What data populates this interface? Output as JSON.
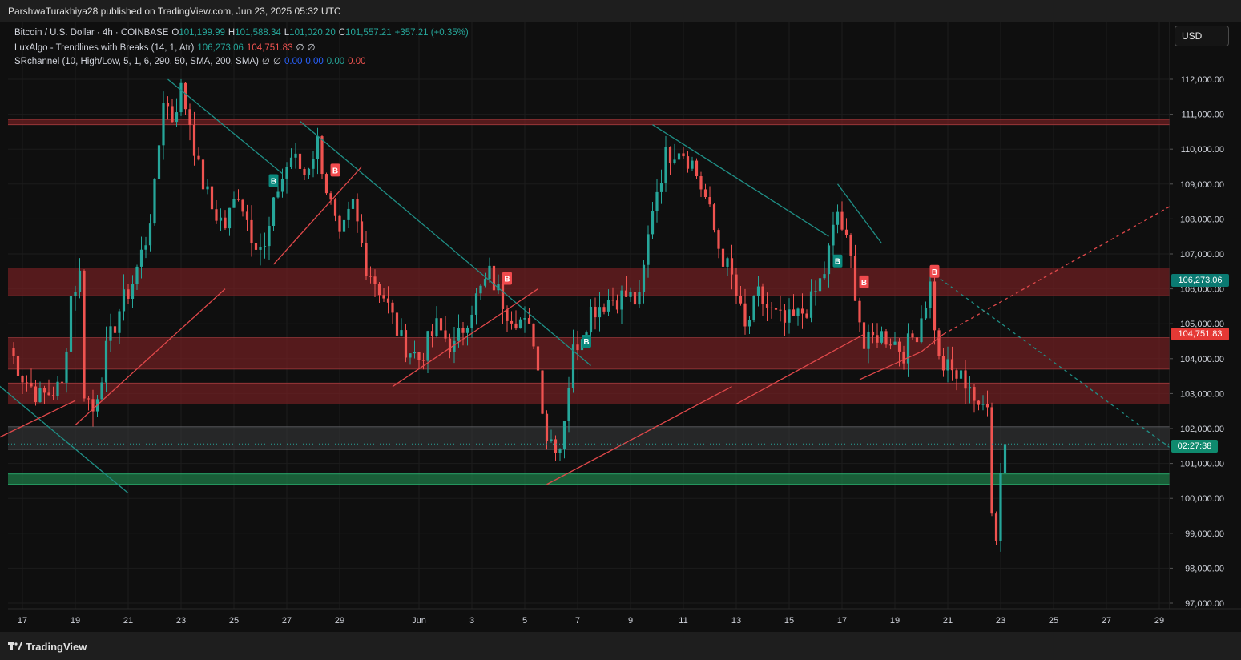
{
  "header": {
    "publish_text": "ParshwaTurakhiya28 published on TradingView.com, Jun 23, 2025 05:32 UTC"
  },
  "legend": {
    "line1": {
      "symbol": "Bitcoin / U.S. Dollar · 4h · COINBASE",
      "o_label": "O",
      "o": "101,199.99",
      "h_label": "H",
      "h": "101,588.34",
      "l_label": "L",
      "l": "101,020.20",
      "c_label": "C",
      "c": "101,557.21",
      "change": "+357.21 (+0.35%)"
    },
    "line2": {
      "name": "LuxAlgo - Trendlines with Breaks (14, 1, Atr)",
      "v1": "106,273.06",
      "v2": "104,751.83",
      "v3": "∅",
      "v4": "∅"
    },
    "line3": {
      "name": "SRchannel (10, High/Low, 5, 1, 6, 290, 50, SMA, 200, SMA)",
      "v1": "∅",
      "v2": "∅",
      "v3": "0.00",
      "v4": "0.00",
      "v5": "0.00",
      "v6": "0.00"
    }
  },
  "currency_button": "USD",
  "price_tags": {
    "upper_trend": "106,273.06",
    "lower_trend": "104,751.83",
    "countdown": "02:27:38"
  },
  "footer": {
    "brand": "TradingView"
  },
  "colors": {
    "up": "#26a69a",
    "down": "#ef5350",
    "zone_red": "#7a1f24",
    "zone_green": "#1e7a4a",
    "zone_gray": "#3a3a3a",
    "background": "#0f0f0f"
  },
  "chart_data": {
    "type": "candlestick",
    "ylim": [
      96600,
      112700
    ],
    "y_ticks": [
      97000,
      98000,
      99000,
      100000,
      101000,
      102000,
      103000,
      104000,
      105000,
      106000,
      107000,
      108000,
      109000,
      110000,
      111000,
      112000
    ],
    "y_tick_labels": [
      "97,000.00",
      "98,000.00",
      "99,000.00",
      "100,000.00",
      "101,000.00",
      "102,000.00",
      "103,000.00",
      "104,000.00",
      "105,000.00",
      "106,000.00",
      "107,000.00",
      "108,000.00",
      "109,000.00",
      "110,000.00",
      "111,000.00",
      "112,000.00"
    ],
    "x_ticks": [
      "May 17",
      "May 19",
      "May 21",
      "May 23",
      "May 25",
      "May 27",
      "May 29",
      "Jun 1",
      "Jun 3",
      "Jun 5",
      "Jun 7",
      "Jun 9",
      "Jun 11",
      "Jun 13",
      "Jun 15",
      "Jun 17",
      "Jun 19",
      "Jun 21",
      "Jun 23",
      "Jun 25",
      "Jun 27",
      "Jun 29"
    ],
    "x_tick_labels": [
      "17",
      "19",
      "21",
      "23",
      "25",
      "27",
      "29",
      "Jun",
      "3",
      "5",
      "7",
      "9",
      "11",
      "13",
      "15",
      "17",
      "19",
      "21",
      "23",
      "25",
      "27",
      "29"
    ],
    "last_close": 101557.21,
    "close_path": [
      [
        "May 16 12:00",
        104300
      ],
      [
        "May 17 00:00",
        103500
      ],
      [
        "May 17 16:00",
        102900
      ],
      [
        "May 18 12:00",
        103200
      ],
      [
        "May 18 20:00",
        105800
      ],
      [
        "May 19 04:00",
        106400
      ],
      [
        "May 19 08:00",
        103100
      ],
      [
        "May 19 16:00",
        102500
      ],
      [
        "May 20 04:00",
        104200
      ],
      [
        "May 20 16:00",
        105400
      ],
      [
        "May 21 04:00",
        106200
      ],
      [
        "May 21 16:00",
        107400
      ],
      [
        "May 22 00:00",
        108800
      ],
      [
        "May 22 08:00",
        111500
      ],
      [
        "May 22 16:00",
        110900
      ],
      [
        "May 23 00:00",
        111700
      ],
      [
        "May 23 08:00",
        110800
      ],
      [
        "May 23 16:00",
        109400
      ],
      [
        "May 24 04:00",
        108300
      ],
      [
        "May 24 16:00",
        107800
      ],
      [
        "May 25 04:00",
        108800
      ],
      [
        "May 25 16:00",
        107600
      ],
      [
        "May 26 04:00",
        107100
      ],
      [
        "May 26 16:00",
        108900
      ],
      [
        "May 27 04:00",
        109800
      ],
      [
        "May 27 16:00",
        109300
      ],
      [
        "May 28 04:00",
        110200
      ],
      [
        "May 28 12:00",
        108900
      ],
      [
        "May 29 00:00",
        107300
      ],
      [
        "May 29 12:00",
        108400
      ],
      [
        "May 30 00:00",
        106700
      ],
      [
        "May 30 16:00",
        105800
      ],
      [
        "May 31 08:00",
        104500
      ],
      [
        "Jun 1 00:00",
        104000
      ],
      [
        "Jun 1 16:00",
        104900
      ],
      [
        "Jun 2 08:00",
        104300
      ],
      [
        "Jun 3 00:00",
        105500
      ],
      [
        "Jun 3 16:00",
        106400
      ],
      [
        "Jun 4 08:00",
        105400
      ],
      [
        "Jun 4 20:00",
        105100
      ],
      [
        "Jun 5 08:00",
        104600
      ],
      [
        "Jun 5 20:00",
        101800
      ],
      [
        "Jun 6 08:00",
        101500
      ],
      [
        "Jun 6 20:00",
        104200
      ],
      [
        "Jun 7 12:00",
        105400
      ],
      [
        "Jun 8 04:00",
        105700
      ],
      [
        "Jun 8 20:00",
        105800
      ],
      [
        "Jun 9 08:00",
        105600
      ],
      [
        "Jun 9 20:00",
        108400
      ],
      [
        "Jun 10 08:00",
        109800
      ],
      [
        "Jun 10 20:00",
        110100
      ],
      [
        "Jun 11 08:00",
        109600
      ],
      [
        "Jun 11 20:00",
        108600
      ],
      [
        "Jun 12 08:00",
        107200
      ],
      [
        "Jun 12 20:00",
        106300
      ],
      [
        "Jun 13 08:00",
        104800
      ],
      [
        "Jun 13 20:00",
        105800
      ],
      [
        "Jun 14 08:00",
        105300
      ],
      [
        "Jun 14 20:00",
        105000
      ],
      [
        "Jun 15 08:00",
        105200
      ],
      [
        "Jun 15 20:00",
        105600
      ],
      [
        "Jun 16 08:00",
        106500
      ],
      [
        "Jun 16 20:00",
        108200
      ],
      [
        "Jun 17 08:00",
        106800
      ],
      [
        "Jun 17 20:00",
        104300
      ],
      [
        "Jun 18 08:00",
        104700
      ],
      [
        "Jun 18 20:00",
        104600
      ],
      [
        "Jun 19 08:00",
        104200
      ],
      [
        "Jun 19 20:00",
        104800
      ],
      [
        "Jun 20 08:00",
        106100
      ],
      [
        "Jun 20 16:00",
        103900
      ],
      [
        "Jun 21 08:00",
        103500
      ],
      [
        "Jun 21 20:00",
        103300
      ],
      [
        "Jun 22 04:00",
        102400
      ],
      [
        "Jun 22 12:00",
        102900
      ],
      [
        "Jun 22 16:00",
        99800
      ],
      [
        "Jun 22 20:00",
        98800
      ],
      [
        "Jun 23 00:00",
        100900
      ],
      [
        "Jun 23 04:00",
        101557
      ]
    ],
    "sr_zones": [
      {
        "from": 110700,
        "to": 110850,
        "color": "red"
      },
      {
        "from": 105800,
        "to": 106600,
        "color": "red"
      },
      {
        "from": 103700,
        "to": 104600,
        "color": "red"
      },
      {
        "from": 102700,
        "to": 103300,
        "color": "red"
      },
      {
        "from": 101400,
        "to": 102050,
        "color": "gray"
      },
      {
        "from": 100400,
        "to": 100700,
        "color": "green"
      }
    ],
    "trendlines": [
      {
        "color": "teal",
        "points": [
          [
            "May 22 12:00",
            112000
          ],
          [
            "May 26 20:00",
            109300
          ]
        ]
      },
      {
        "color": "teal",
        "points": [
          [
            "May 27 12:00",
            110800
          ],
          [
            "Jun 7 12:00",
            103800
          ]
        ]
      },
      {
        "color": "teal",
        "points": [
          [
            "Jun 9 20:00",
            110700
          ],
          [
            "Jun 16 12:00",
            107500
          ]
        ]
      },
      {
        "color": "teal",
        "points": [
          [
            "Jun 16 20:00",
            109000
          ],
          [
            "Jun 18 12:00",
            107300
          ]
        ]
      },
      {
        "color": "teal",
        "points": [
          [
            "May 16 00:00",
            103300
          ],
          [
            "May 21 00:00",
            100150
          ]
        ]
      },
      {
        "color": "red",
        "points": [
          [
            "May 16 00:00",
            101700
          ],
          [
            "May 19 00:00",
            102800
          ]
        ]
      },
      {
        "color": "red",
        "points": [
          [
            "May 19 00:00",
            102100
          ],
          [
            "May 24 16:00",
            106000
          ]
        ]
      },
      {
        "color": "red",
        "points": [
          [
            "May 26 12:00",
            106700
          ],
          [
            "May 29 20:00",
            109500
          ]
        ]
      },
      {
        "color": "red",
        "points": [
          [
            "May 31 00:00",
            103200
          ],
          [
            "Jun 5 12:00",
            106000
          ]
        ]
      },
      {
        "color": "red",
        "points": [
          [
            "Jun 5 20:00",
            100400
          ],
          [
            "Jun 12 20:00",
            103200
          ]
        ]
      },
      {
        "color": "red",
        "points": [
          [
            "Jun 13 00:00",
            102700
          ],
          [
            "Jun 17 20:00",
            104700
          ]
        ]
      },
      {
        "color": "red",
        "points": [
          [
            "Jun 17 16:00",
            103400
          ],
          [
            "Jun 20 00:00",
            104200
          ]
        ]
      },
      {
        "color": "red",
        "points": [
          [
            "Jun 20 00:00",
            104200
          ],
          [
            "Jun 20 20:00",
            104700
          ]
        ]
      },
      {
        "color": "red",
        "dashed": true,
        "points": [
          [
            "Jun 20 20:00",
            104700
          ],
          [
            "Jun 29 12:00",
            108400
          ]
        ]
      },
      {
        "color": "teal",
        "dashed": true,
        "points": [
          [
            "Jun 20 08:00",
            106500
          ],
          [
            "Jun 29 12:00",
            101400
          ]
        ]
      }
    ],
    "break_labels": [
      {
        "text": "B",
        "time": "May 26 12:00",
        "price": 109100,
        "color": "teal"
      },
      {
        "text": "B",
        "time": "May 28 20:00",
        "price": 109400,
        "color": "red"
      },
      {
        "text": "B",
        "time": "Jun 4 08:00",
        "price": 106300,
        "color": "red"
      },
      {
        "text": "B",
        "time": "Jun 7 08:00",
        "price": 104500,
        "color": "teal"
      },
      {
        "text": "B",
        "time": "Jun 16 20:00",
        "price": 106800,
        "color": "teal"
      },
      {
        "text": "B",
        "time": "Jun 17 20:00",
        "price": 106200,
        "color": "red"
      },
      {
        "text": "B",
        "time": "Jun 20 12:00",
        "price": 106500,
        "color": "red"
      }
    ]
  }
}
